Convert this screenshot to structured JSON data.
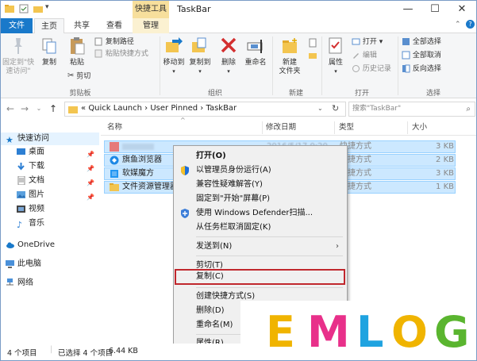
{
  "window": {
    "title": "TaskBar",
    "context_tab_group": "快捷工具",
    "controls": {
      "minimize": "—",
      "maximize": "☐",
      "close": "✕"
    }
  },
  "ribbon_tabs": [
    {
      "label": "文件"
    },
    {
      "label": "主页"
    },
    {
      "label": "共享"
    },
    {
      "label": "查看"
    },
    {
      "label": "管理"
    }
  ],
  "ribbon": {
    "clipboard": {
      "pin_label": "固定到\"快\n速访问\"",
      "copy_label": "复制",
      "paste_label": "粘贴",
      "copy_path": "复制路径",
      "paste_shortcut": "粘贴快捷方式",
      "cut": "剪切",
      "group": "剪贴板"
    },
    "organize": {
      "move_to": "移动到",
      "copy_to": "复制到",
      "delete": "删除",
      "rename": "重命名",
      "group": "组织"
    },
    "new": {
      "new_folder": "新建\n文件夹",
      "group": "新建"
    },
    "open": {
      "properties": "属性",
      "open": "打开 ▾",
      "edit": "编辑",
      "history": "历史记录",
      "group": "打开"
    },
    "select": {
      "select_all": "全部选择",
      "select_none": "全部取消",
      "invert": "反向选择",
      "group": "选择"
    }
  },
  "address": {
    "path": [
      "«",
      "Quick Launch",
      "›",
      "User Pinned",
      "›",
      "TaskBar"
    ],
    "search_placeholder": "搜索\"TaskBar\""
  },
  "nav_pane": {
    "items": [
      {
        "label": "快速访问",
        "icon": "star-icon",
        "pinned": false
      },
      {
        "label": "桌面",
        "icon": "desktop-folder-icon",
        "pinned": true
      },
      {
        "label": "下载",
        "icon": "download-folder-icon",
        "pinned": true
      },
      {
        "label": "文档",
        "icon": "documents-folder-icon",
        "pinned": true
      },
      {
        "label": "图片",
        "icon": "pictures-folder-icon",
        "pinned": true
      },
      {
        "label": "视频",
        "icon": "videos-folder-icon",
        "pinned": false
      },
      {
        "label": "音乐",
        "icon": "music-folder-icon",
        "pinned": false
      },
      {
        "label": "OneDrive",
        "icon": "cloud-icon",
        "pinned": false
      },
      {
        "label": "此电脑",
        "icon": "computer-icon",
        "pinned": false
      },
      {
        "label": "网络",
        "icon": "network-icon",
        "pinned": false
      }
    ]
  },
  "columns": {
    "name": "名称",
    "modified": "修改日期",
    "type": "类型",
    "size": "大小"
  },
  "files": [
    {
      "name": "",
      "modified": "2016/5/17 0:20",
      "type": "快捷方式",
      "size": "3 KB",
      "blurred": true
    },
    {
      "name": "旗鱼浏览器",
      "modified": "",
      "type": "快捷方式",
      "size": "2 KB"
    },
    {
      "name": "软媒魔方",
      "modified": "",
      "type": "快捷方式",
      "size": "3 KB"
    },
    {
      "name": "文件资源管理器",
      "modified": "",
      "type": "快捷方式",
      "size": "1 KB"
    }
  ],
  "context_menu": {
    "items": [
      {
        "label": "打开(O)",
        "bold": true
      },
      {
        "label": "以管理员身份运行(A)",
        "icon": "shield-icon"
      },
      {
        "label": "兼容性疑难解答(Y)"
      },
      {
        "label": "固定到\"开始\"屏幕(P)"
      },
      {
        "label": "使用 Windows Defender扫描...",
        "icon": "defender-icon"
      },
      {
        "label": "从任务栏取消固定(K)"
      },
      {
        "label": "发送到(N)",
        "submenu": true
      },
      {
        "label": "剪切(T)"
      },
      {
        "label": "复制(C)",
        "highlighted": true
      },
      {
        "label": "创建快捷方式(S)"
      },
      {
        "label": "删除(D)"
      },
      {
        "label": "重命名(M)"
      },
      {
        "label": "属性(R)"
      }
    ]
  },
  "status": {
    "count": "4 个项目",
    "selected": "已选择 4 个项目",
    "size": "6.44 KB"
  },
  "watermark": {
    "letters": [
      "E",
      "M",
      "L",
      "O",
      "G"
    ],
    "colors": [
      "#f0b400",
      "#e8308a",
      "#1fa3e0",
      "#f0b400",
      "#5ab52f"
    ]
  },
  "colors": {
    "accent": "#1979ca",
    "selection": "#cce8ff",
    "highlight_border": "#c0272d"
  }
}
